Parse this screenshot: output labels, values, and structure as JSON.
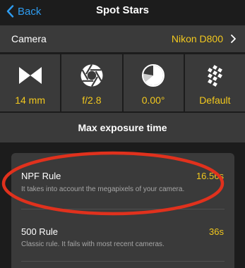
{
  "nav": {
    "back_label": "Back",
    "title": "Spot Stars"
  },
  "camera": {
    "label": "Camera",
    "value": "Nikon D800"
  },
  "params": [
    {
      "icon": "focal-length-icon",
      "value": "14 mm"
    },
    {
      "icon": "aperture-icon",
      "value": "f/2.8"
    },
    {
      "icon": "declination-icon",
      "value": "0.00°"
    },
    {
      "icon": "sensor-grid-icon",
      "value": "Default"
    }
  ],
  "section": {
    "title": "Max exposure time"
  },
  "rules": [
    {
      "name": "NPF Rule",
      "value": "16.56s",
      "description": "It takes into account the megapixels of your camera."
    },
    {
      "name": "500 Rule",
      "value": "36s",
      "description": "Classic rule. It fails with most recent cameras."
    }
  ],
  "colors": {
    "accent": "#f2c81e",
    "link": "#2e9cf0",
    "annotation": "#e0311d"
  }
}
